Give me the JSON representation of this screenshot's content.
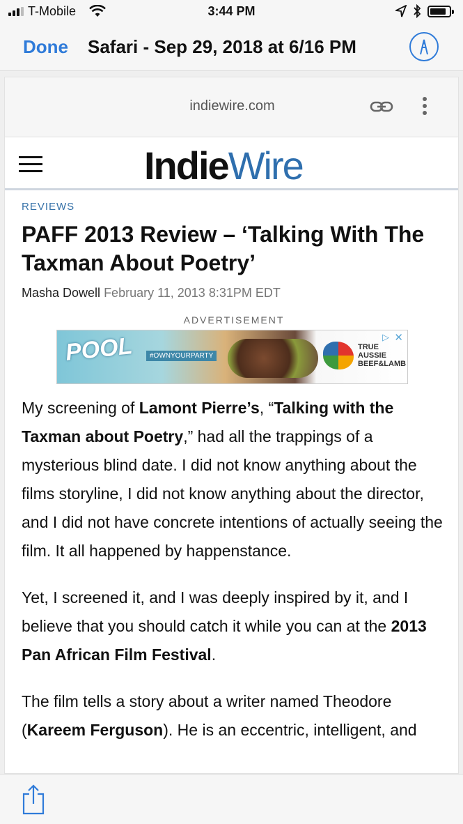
{
  "status_bar": {
    "carrier": "T-Mobile",
    "time": "3:44 PM"
  },
  "markup_header": {
    "done_label": "Done",
    "title": "Safari - Sep 29, 2018 at 6/16 PM"
  },
  "browser": {
    "url": "indiewire.com"
  },
  "site": {
    "logo_part1": "Indie",
    "logo_part2": "Wire"
  },
  "article": {
    "section": "REVIEWS",
    "headline": "PAFF 2013 Review – ‘Talking With The Taxman About Poetry’",
    "author": "Masha Dowell",
    "date": "February 11, 2013 8:31PM EDT",
    "ad_label": "ADVERTISEMENT",
    "ad": {
      "pool_text": "POOL",
      "hashtag": "#OWNYOURPARTY",
      "brand_line1": "TRUE",
      "brand_line2": "AUSSIE",
      "brand_line3": "BEEF&LAMB"
    },
    "p1_a": "My screening of ",
    "p1_b": "Lamont Pierre’s",
    "p1_c": ", “",
    "p1_d": "Talking with the Taxman about Poetry",
    "p1_e": ",” had all the trappings of a mysterious blind date.  I did not know anything about the films storyline, I did not know anything about the director, and I did not have concrete intentions of actually seeing the film. It all happened by happenstance.",
    "p2_a": "Yet, I screened it, and I was deeply inspired by it, and I believe that you should catch it while you can at the ",
    "p2_b": "2013 Pan African Film Festival",
    "p2_c": ".",
    "p3_a": "The film tells a story about a writer named Theodore (",
    "p3_b": "Kareem Ferguson",
    "p3_c": "). He is an eccentric, intelligent, and"
  },
  "icons": {
    "wifi": "wifi-icon",
    "location": "location-arrow-icon",
    "bluetooth": "bluetooth-icon",
    "battery": "battery-icon",
    "markup": "markup-pen-icon",
    "link": "link-icon",
    "more": "more-vertical-icon",
    "menu": "hamburger-menu-icon",
    "share": "share-icon"
  },
  "colors": {
    "accent_blue": "#2f7bd9",
    "brand_blue": "#2f6fae"
  }
}
